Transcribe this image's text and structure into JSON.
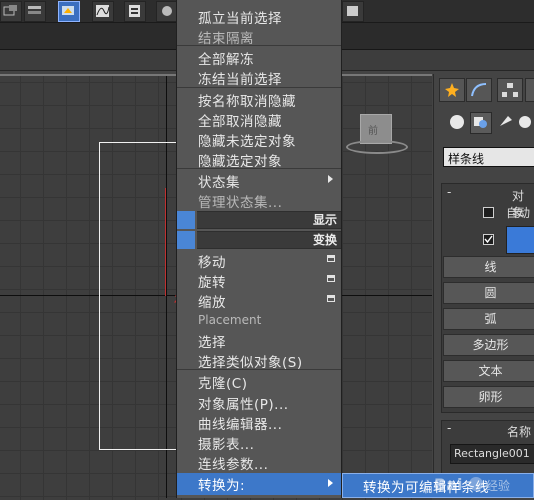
{
  "context_menu": {
    "items": [
      {
        "label": "孤立当前选择",
        "dim": false
      },
      {
        "label": "结束隔离",
        "dim": true
      },
      {
        "label": "全部解冻",
        "dim": false
      },
      {
        "label": "冻结当前选择",
        "dim": false
      },
      {
        "label": "按名称取消隐藏",
        "dim": false
      },
      {
        "label": "全部取消隐藏",
        "dim": false
      },
      {
        "label": "隐藏未选定对象",
        "dim": false
      },
      {
        "label": "隐藏选定对象",
        "dim": false
      },
      {
        "label": "状态集",
        "dim": false
      },
      {
        "label": "管理状态集...",
        "dim": true
      },
      {
        "label": "移动",
        "dim": false
      },
      {
        "label": "旋转",
        "dim": false
      },
      {
        "label": "缩放",
        "dim": false
      },
      {
        "label": "Placement",
        "dim": true
      },
      {
        "label": "选择",
        "dim": false
      },
      {
        "label": "选择类似对象(S)",
        "dim": false
      },
      {
        "label": "克隆(C)",
        "dim": false
      },
      {
        "label": "对象属性(P)...",
        "dim": false
      },
      {
        "label": "曲线编辑器...",
        "dim": false
      },
      {
        "label": "摄影表...",
        "dim": false
      },
      {
        "label": "连线参数...",
        "dim": false
      },
      {
        "label": "转换为:",
        "dim": false
      }
    ],
    "headers": {
      "display": "显示",
      "transform": "变换"
    }
  },
  "submenu": {
    "convert_to_editable_spline": "转换为可编辑样条线"
  },
  "command_panel": {
    "category_dropdown": "样条线",
    "object_type_header": "对象",
    "auto_grid_label": "自动",
    "buttons": [
      "线",
      "圆",
      "弧",
      "多边形",
      "文本",
      "卵形"
    ],
    "name_color_header": "名称",
    "object_name": "Rectangle001"
  },
  "watermark": "Bai 经验",
  "colors": {
    "menu_bg": "#565656",
    "highlight": "#3d78c9",
    "viewport_bg": "#3e3e3e",
    "object_color": "#3a7ad8"
  }
}
